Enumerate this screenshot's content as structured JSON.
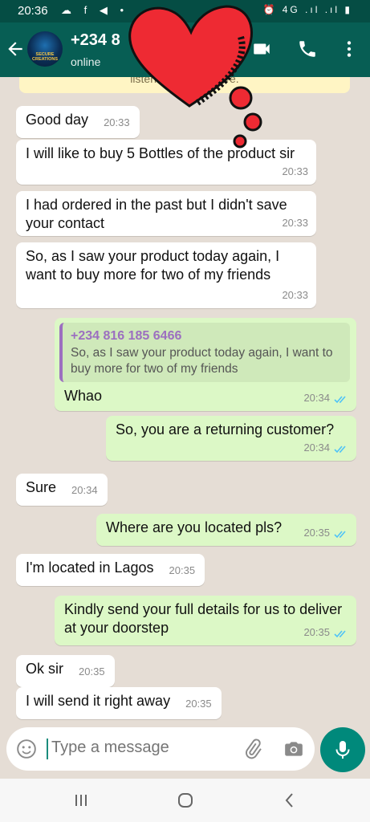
{
  "status_bar": {
    "time": "20:36",
    "left_icons": "☁ f ◀ •",
    "right_icons": "⏰ 4G .ıl .ıl ▮"
  },
  "header": {
    "contact_name": "+234 8",
    "status": "online",
    "avatar_text": "SECURE CREATIONS"
  },
  "notice": {
    "text": "listen to the           arn more."
  },
  "messages": [
    {
      "direction": "in",
      "text": "Good day",
      "time": "20:33"
    },
    {
      "direction": "in",
      "text": "I will like to buy 5 Bottles of the product sir",
      "time": "20:33"
    },
    {
      "direction": "in",
      "text": "I had ordered in the past but I didn't save your contact",
      "time": "20:33"
    },
    {
      "direction": "in",
      "text": "So, as I saw your product today again, I want to buy more for two of my friends",
      "time": "20:33"
    },
    {
      "direction": "out",
      "quote_author": "+234 816 185 6466",
      "quote_text": "So, as I saw your product today again, I want to buy more for two of my friends",
      "text": "Whao",
      "time": "20:34",
      "read": true
    },
    {
      "direction": "out",
      "text": "So, you are a returning customer?",
      "time": "20:34",
      "read": true
    },
    {
      "direction": "in",
      "text": "Sure",
      "time": "20:34"
    },
    {
      "direction": "out",
      "text": "Where are you located pls?",
      "time": "20:35",
      "read": true
    },
    {
      "direction": "in",
      "text": "I'm located in Lagos",
      "time": "20:35"
    },
    {
      "direction": "out",
      "text": "Kindly send your full details for us to deliver at your doorstep",
      "time": "20:35",
      "read": true
    },
    {
      "direction": "in",
      "text": "Ok sir",
      "time": "20:35"
    },
    {
      "direction": "in",
      "text": "I will send it right away",
      "time": "20:35"
    }
  ],
  "composer": {
    "placeholder": "Type a message"
  },
  "icons": {
    "back": "arrow-left-icon",
    "video": "video-camera-icon",
    "call": "phone-icon",
    "menu": "more-vertical-icon",
    "emoji": "smiley-icon",
    "attach": "paperclip-icon",
    "camera": "camera-icon",
    "mic": "microphone-icon",
    "read_receipt": "double-check-icon"
  },
  "colors": {
    "header": "#075e54",
    "status_bar": "#054d44",
    "outgoing_bubble": "#dcf8c6",
    "incoming_bubble": "#ffffff",
    "read_tick": "#4fc3f7",
    "accent": "#00897b",
    "quote_author": "#9c6fc0"
  }
}
